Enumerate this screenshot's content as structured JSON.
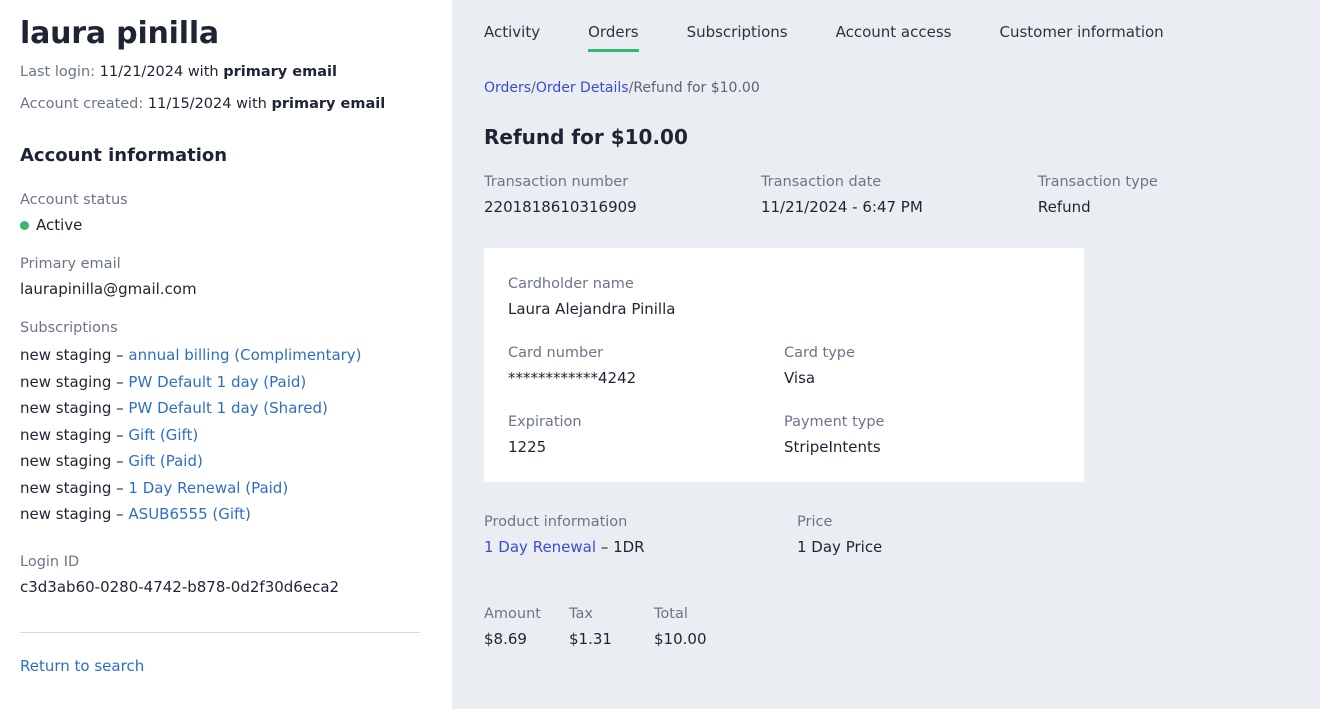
{
  "sidebar": {
    "account_name": "laura pinilla",
    "last_login": {
      "label": "Last login:",
      "date": "11/21/2024",
      "with": "with",
      "method": "primary email"
    },
    "account_created": {
      "label": "Account created:",
      "date": "11/15/2024",
      "with": "with",
      "method": "primary email"
    },
    "section_title": "Account information",
    "account_status": {
      "label": "Account status",
      "value": "Active",
      "dot_color": "#35b96e"
    },
    "primary_email": {
      "label": "Primary email",
      "value": "laurapinilla@gmail.com"
    },
    "subscriptions": {
      "label": "Subscriptions",
      "items": [
        {
          "prefix": "new staging – ",
          "link": "annual billing (Complimentary)"
        },
        {
          "prefix": "new staging – ",
          "link": "PW Default 1 day (Paid)"
        },
        {
          "prefix": "new staging – ",
          "link": "PW Default 1 day (Shared)"
        },
        {
          "prefix": "new staging – ",
          "link": "Gift (Gift)"
        },
        {
          "prefix": "new staging – ",
          "link": "Gift (Paid)"
        },
        {
          "prefix": "new staging – ",
          "link": "1 Day Renewal (Paid)"
        },
        {
          "prefix": "new staging – ",
          "link": "ASUB6555 (Gift)"
        }
      ]
    },
    "login_id": {
      "label": "Login ID",
      "value": "c3d3ab60-0280-4742-b878-0d2f30d6eca2"
    },
    "return_link": "Return to search"
  },
  "main": {
    "tabs": [
      {
        "label": "Activity",
        "active": false
      },
      {
        "label": "Orders",
        "active": true
      },
      {
        "label": "Subscriptions",
        "active": false
      },
      {
        "label": "Account access",
        "active": false
      },
      {
        "label": "Customer information",
        "active": false
      }
    ],
    "active_tab_color": "#35b96e",
    "breadcrumb": {
      "link1": "Orders",
      "sep1": "/",
      "link2": "Order Details",
      "sep2": "/",
      "current": "Refund for $10.00"
    },
    "heading": "Refund for $10.00",
    "transaction": {
      "number_label": "Transaction number",
      "number_value": "2201818610316909",
      "date_label": "Transaction date",
      "date_value": "11/21/2024 - 6:47 PM",
      "type_label": "Transaction type",
      "type_value": "Refund"
    },
    "card": {
      "cardholder_label": "Cardholder name",
      "cardholder_value": "Laura Alejandra Pinilla",
      "card_number_label": "Card number",
      "card_number_value": "************4242",
      "card_type_label": "Card type",
      "card_type_value": "Visa",
      "expiration_label": "Expiration",
      "expiration_value": "1225",
      "payment_type_label": "Payment type",
      "payment_type_value": "StripeIntents"
    },
    "product": {
      "info_label": "Product information",
      "info_link": "1 Day Renewal",
      "info_suffix": " – 1DR",
      "price_label": "Price",
      "price_value": "1 Day Price"
    },
    "totals": {
      "amount_label": "Amount",
      "amount_value": "$8.69",
      "tax_label": "Tax",
      "tax_value": "$1.31",
      "total_label": "Total",
      "total_value": "$10.00"
    }
  }
}
